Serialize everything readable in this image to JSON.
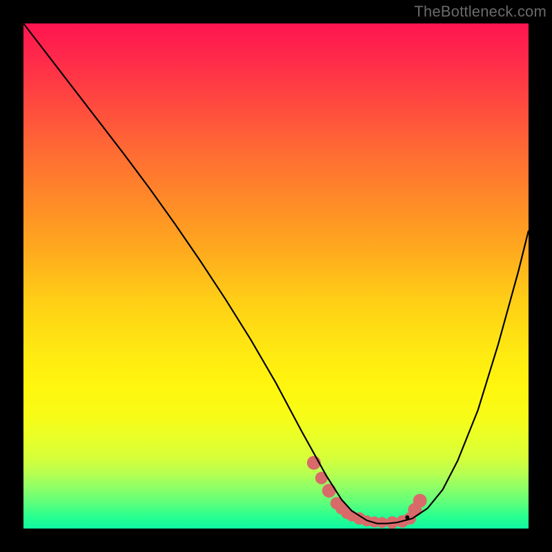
{
  "watermark": "TheBottleneck.com",
  "colors": {
    "curve": "#000000",
    "marker_fill": "#d96a6a",
    "marker_stroke": "#c75555",
    "single_dot": "#000000"
  },
  "chart_data": {
    "type": "line",
    "title": "",
    "xlabel": "",
    "ylabel": "",
    "xlim": [
      0,
      100
    ],
    "ylim": [
      0,
      100
    ],
    "series": [
      {
        "name": "curve",
        "x": [
          0,
          5,
          10,
          15,
          20,
          25,
          30,
          35,
          40,
          45,
          50,
          55,
          60,
          63,
          65,
          68,
          70,
          72,
          74,
          77,
          80,
          83,
          86,
          90,
          94,
          98,
          100
        ],
        "y": [
          100,
          93.5,
          87,
          80.5,
          74,
          67.3,
          60.3,
          53,
          45.4,
          37.4,
          28.8,
          19.4,
          10.4,
          5.7,
          3.5,
          1.6,
          1.0,
          1.0,
          1.2,
          2.0,
          4.0,
          7.7,
          13.5,
          23.5,
          36.5,
          51.0,
          59.0
        ]
      }
    ],
    "markers": {
      "name": "bottom-cluster",
      "x": [
        57.5,
        59.0,
        60.5,
        62.0,
        63.0,
        64.0,
        65.0,
        66.5,
        68.0,
        69.5,
        71.0,
        73.0,
        75.0,
        76.5,
        77.5,
        78.5
      ],
      "y": [
        13.0,
        10.0,
        7.5,
        5.0,
        4.0,
        3.0,
        2.5,
        2.0,
        1.5,
        1.3,
        1.2,
        1.2,
        1.4,
        2.0,
        3.7,
        5.5
      ],
      "r": [
        10,
        9,
        10,
        9,
        9,
        8,
        8,
        9,
        8,
        8,
        8,
        9,
        9,
        9,
        10,
        10
      ]
    },
    "single_dot": {
      "x": 76.0,
      "y": 2.2,
      "r": 3
    }
  }
}
